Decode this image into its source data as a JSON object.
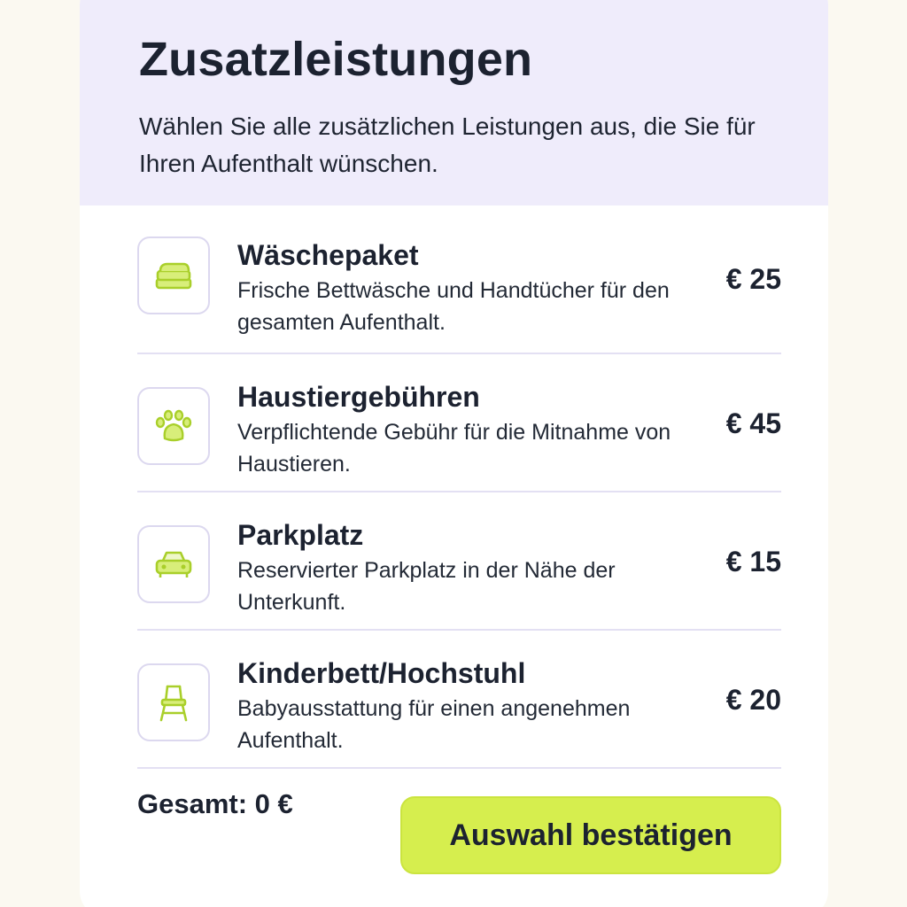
{
  "header": {
    "title": "Zusatzleistungen",
    "subtitle": "Wählen Sie alle zusätzlichen Leistungen aus, die Sie für Ihren Aufenthalt wünschen."
  },
  "services": [
    {
      "title": "Wäschepaket",
      "description": "Frische Bettwäsche und Handtücher für den gesamten Aufenthalt.",
      "price": "€ 25",
      "icon": "laundry-icon"
    },
    {
      "title": "Haustiergebühren",
      "description": "Verpflichtende Gebühr für die Mitnahme von Haustieren.",
      "price": "€ 45",
      "icon": "paw-icon"
    },
    {
      "title": "Parkplatz",
      "description": "Reservierter Parkplatz in der Nähe der Unterkunft.",
      "price": "€ 15",
      "icon": "car-icon"
    },
    {
      "title": "Kinderbett/Hochstuhl",
      "description": "Babyausstattung für einen angenehmen Aufenthalt.",
      "price": "€ 20",
      "icon": "high-chair-icon"
    }
  ],
  "footer": {
    "total": "Gesamt: 0 €",
    "confirm_label": "Auswahl bestätigen"
  },
  "colors": {
    "accent": "#d6ee4e",
    "icon": "#a9cf2a",
    "header_bg": "#efecfb",
    "divider": "#e3e0f3"
  }
}
